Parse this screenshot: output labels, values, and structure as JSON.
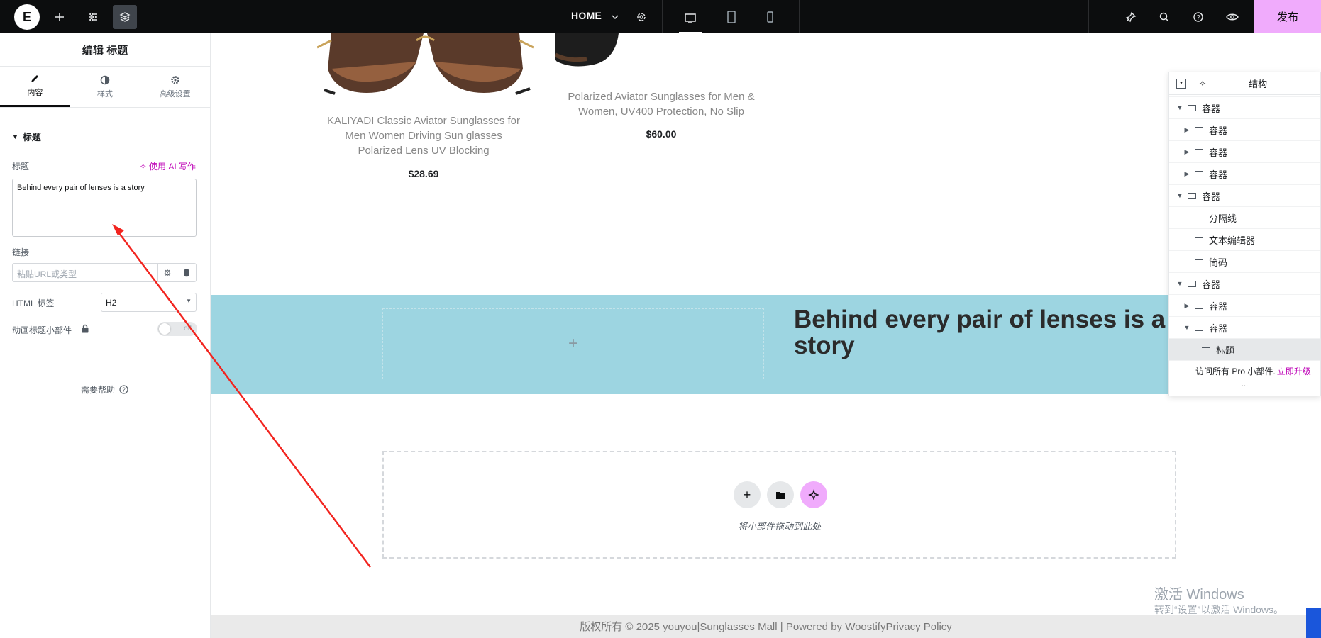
{
  "topbar": {
    "page_label": "HOME",
    "publish_label": "发布"
  },
  "panel": {
    "title": "编辑 标题",
    "tabs": [
      {
        "label": "内容",
        "icon": "pencil-icon"
      },
      {
        "label": "样式",
        "icon": "half-circle-icon"
      },
      {
        "label": "高级设置",
        "icon": "gear-icon"
      }
    ],
    "section_title": "标题",
    "title_label": "标题",
    "ai_link": "使用 AI 写作",
    "title_value": "Behind every pair of lenses is a story",
    "link_label": "链接",
    "link_placeholder": "粘贴URL或类型",
    "html_tag_label": "HTML 标签",
    "html_tag_value": "H2",
    "animated_label": "动画标题小部件",
    "toggle_text": "off",
    "help_label": "需要帮助"
  },
  "canvas": {
    "products": [
      {
        "title_l1": "KALIYADI Classic Aviator Sunglasses for",
        "title_l2": "Men Women Driving Sun glasses",
        "title_l3": "Polarized Lens UV Blocking",
        "price": "$28.69"
      },
      {
        "title_l1": "Polarized Aviator Sunglasses for Men &",
        "title_l2": "Women, UV400 Protection, No Slip",
        "price": "$60.00"
      }
    ],
    "heading": "Behind every pair of lenses is a story",
    "dropzone_text": "将小部件拖动到此处",
    "footer": "版权所有 © 2025 youyou|Sunglasses Mall | Powered by WoostifyPrivacy Policy",
    "watermark_title": "激活 Windows",
    "watermark_sub": "转到“设置”以激活 Windows。"
  },
  "navigator": {
    "title": "结构",
    "rows": [
      {
        "label": "容器",
        "caret": "▼"
      },
      {
        "label": "容器",
        "caret": "▶"
      },
      {
        "label": "容器",
        "caret": "▶"
      },
      {
        "label": "容器",
        "caret": "▶"
      },
      {
        "label": "容器",
        "caret": "▼"
      },
      {
        "label": "分隔线",
        "caret": ""
      },
      {
        "label": "文本编辑器",
        "caret": ""
      },
      {
        "label": "简码",
        "caret": ""
      },
      {
        "label": "容器",
        "caret": "▼"
      },
      {
        "label": "容器",
        "caret": "▶"
      },
      {
        "label": "容器",
        "caret": "▼"
      },
      {
        "label": "标题",
        "caret": ""
      }
    ],
    "upgrade_text": "访问所有 Pro 小部件.",
    "upgrade_link": "立即升级",
    "more": "..."
  },
  "colors": {
    "accent_pink": "#f0abfc",
    "band_blue": "#9dd5e1",
    "ai_magenta": "#c00bb9"
  }
}
